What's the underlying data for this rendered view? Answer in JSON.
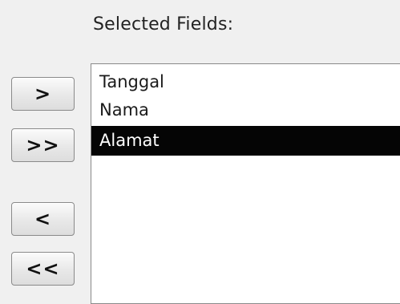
{
  "panel": {
    "title": "Selected Fields:"
  },
  "buttons": {
    "add": ">",
    "add_all": ">>",
    "remove": "<",
    "remove_all": "<<"
  },
  "selected_fields": {
    "items": [
      "Tanggal",
      "Nama",
      "Alamat"
    ],
    "selected_item": "Alamat",
    "selection_color": "#050505"
  }
}
